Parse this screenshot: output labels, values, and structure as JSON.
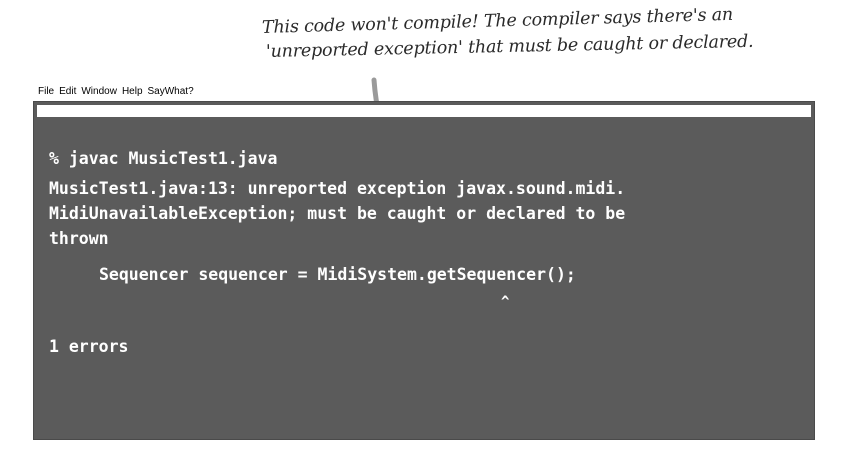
{
  "annotation": {
    "line1": "This code won't compile! The compiler says there's an",
    "line2": "'unreported exception' that must be caught or declared."
  },
  "menubar": {
    "items": [
      "File",
      "Edit",
      "Window",
      "Help",
      "SayWhat?"
    ]
  },
  "terminal": {
    "command": "% javac MusicTest1.java",
    "error_lines": [
      "MusicTest1.java:13: unreported exception javax.sound.midi.",
      "MidiUnavailableException; must be caught or declared to be",
      "thrown"
    ],
    "code_line": "Sequencer sequencer = MidiSystem.getSequencer();",
    "caret": "^",
    "error_count": "1 errors"
  },
  "colors": {
    "terminal_bg": "#5b5b5b",
    "terminal_text": "#ffffff",
    "annotation_ink": "#2a2a2a"
  }
}
